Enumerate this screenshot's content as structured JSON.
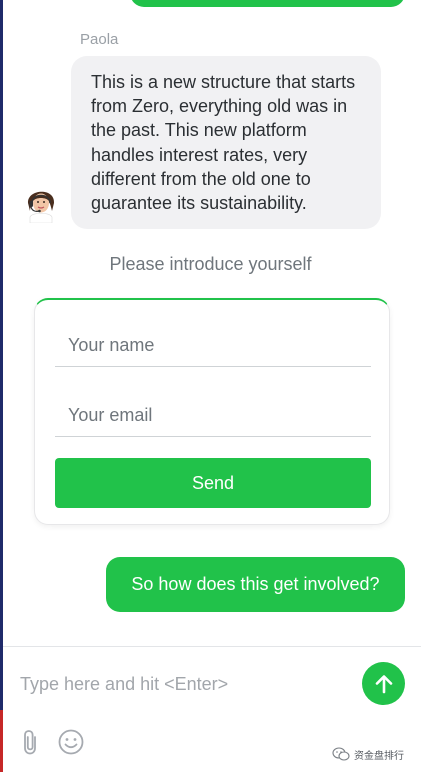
{
  "conversation": {
    "agent": {
      "name": "Paola",
      "message": "This is a new structure that starts from Zero, everything old was in the past. This new platform handles interest rates, very different from the old one to guarantee its sustainability.",
      "avatar_icon": "agent-headset-avatar"
    },
    "intro_prompt": "Please introduce yourself",
    "form": {
      "name_placeholder": "Your name",
      "email_placeholder": "Your email",
      "send_label": "Send"
    },
    "user_message": "So how does this get involved?"
  },
  "composer": {
    "placeholder": "Type here and hit <Enter>",
    "send_icon": "arrow-up-icon",
    "attach_icon": "paperclip-icon",
    "emoji_icon": "smiley-icon"
  },
  "watermark": {
    "text": "资金盘排行",
    "icon": "wechat-icon"
  },
  "colors": {
    "accent": "#21c24a",
    "agent_bubble": "#f1f1f3",
    "text": "#2b2f33",
    "muted": "#6f767c"
  }
}
